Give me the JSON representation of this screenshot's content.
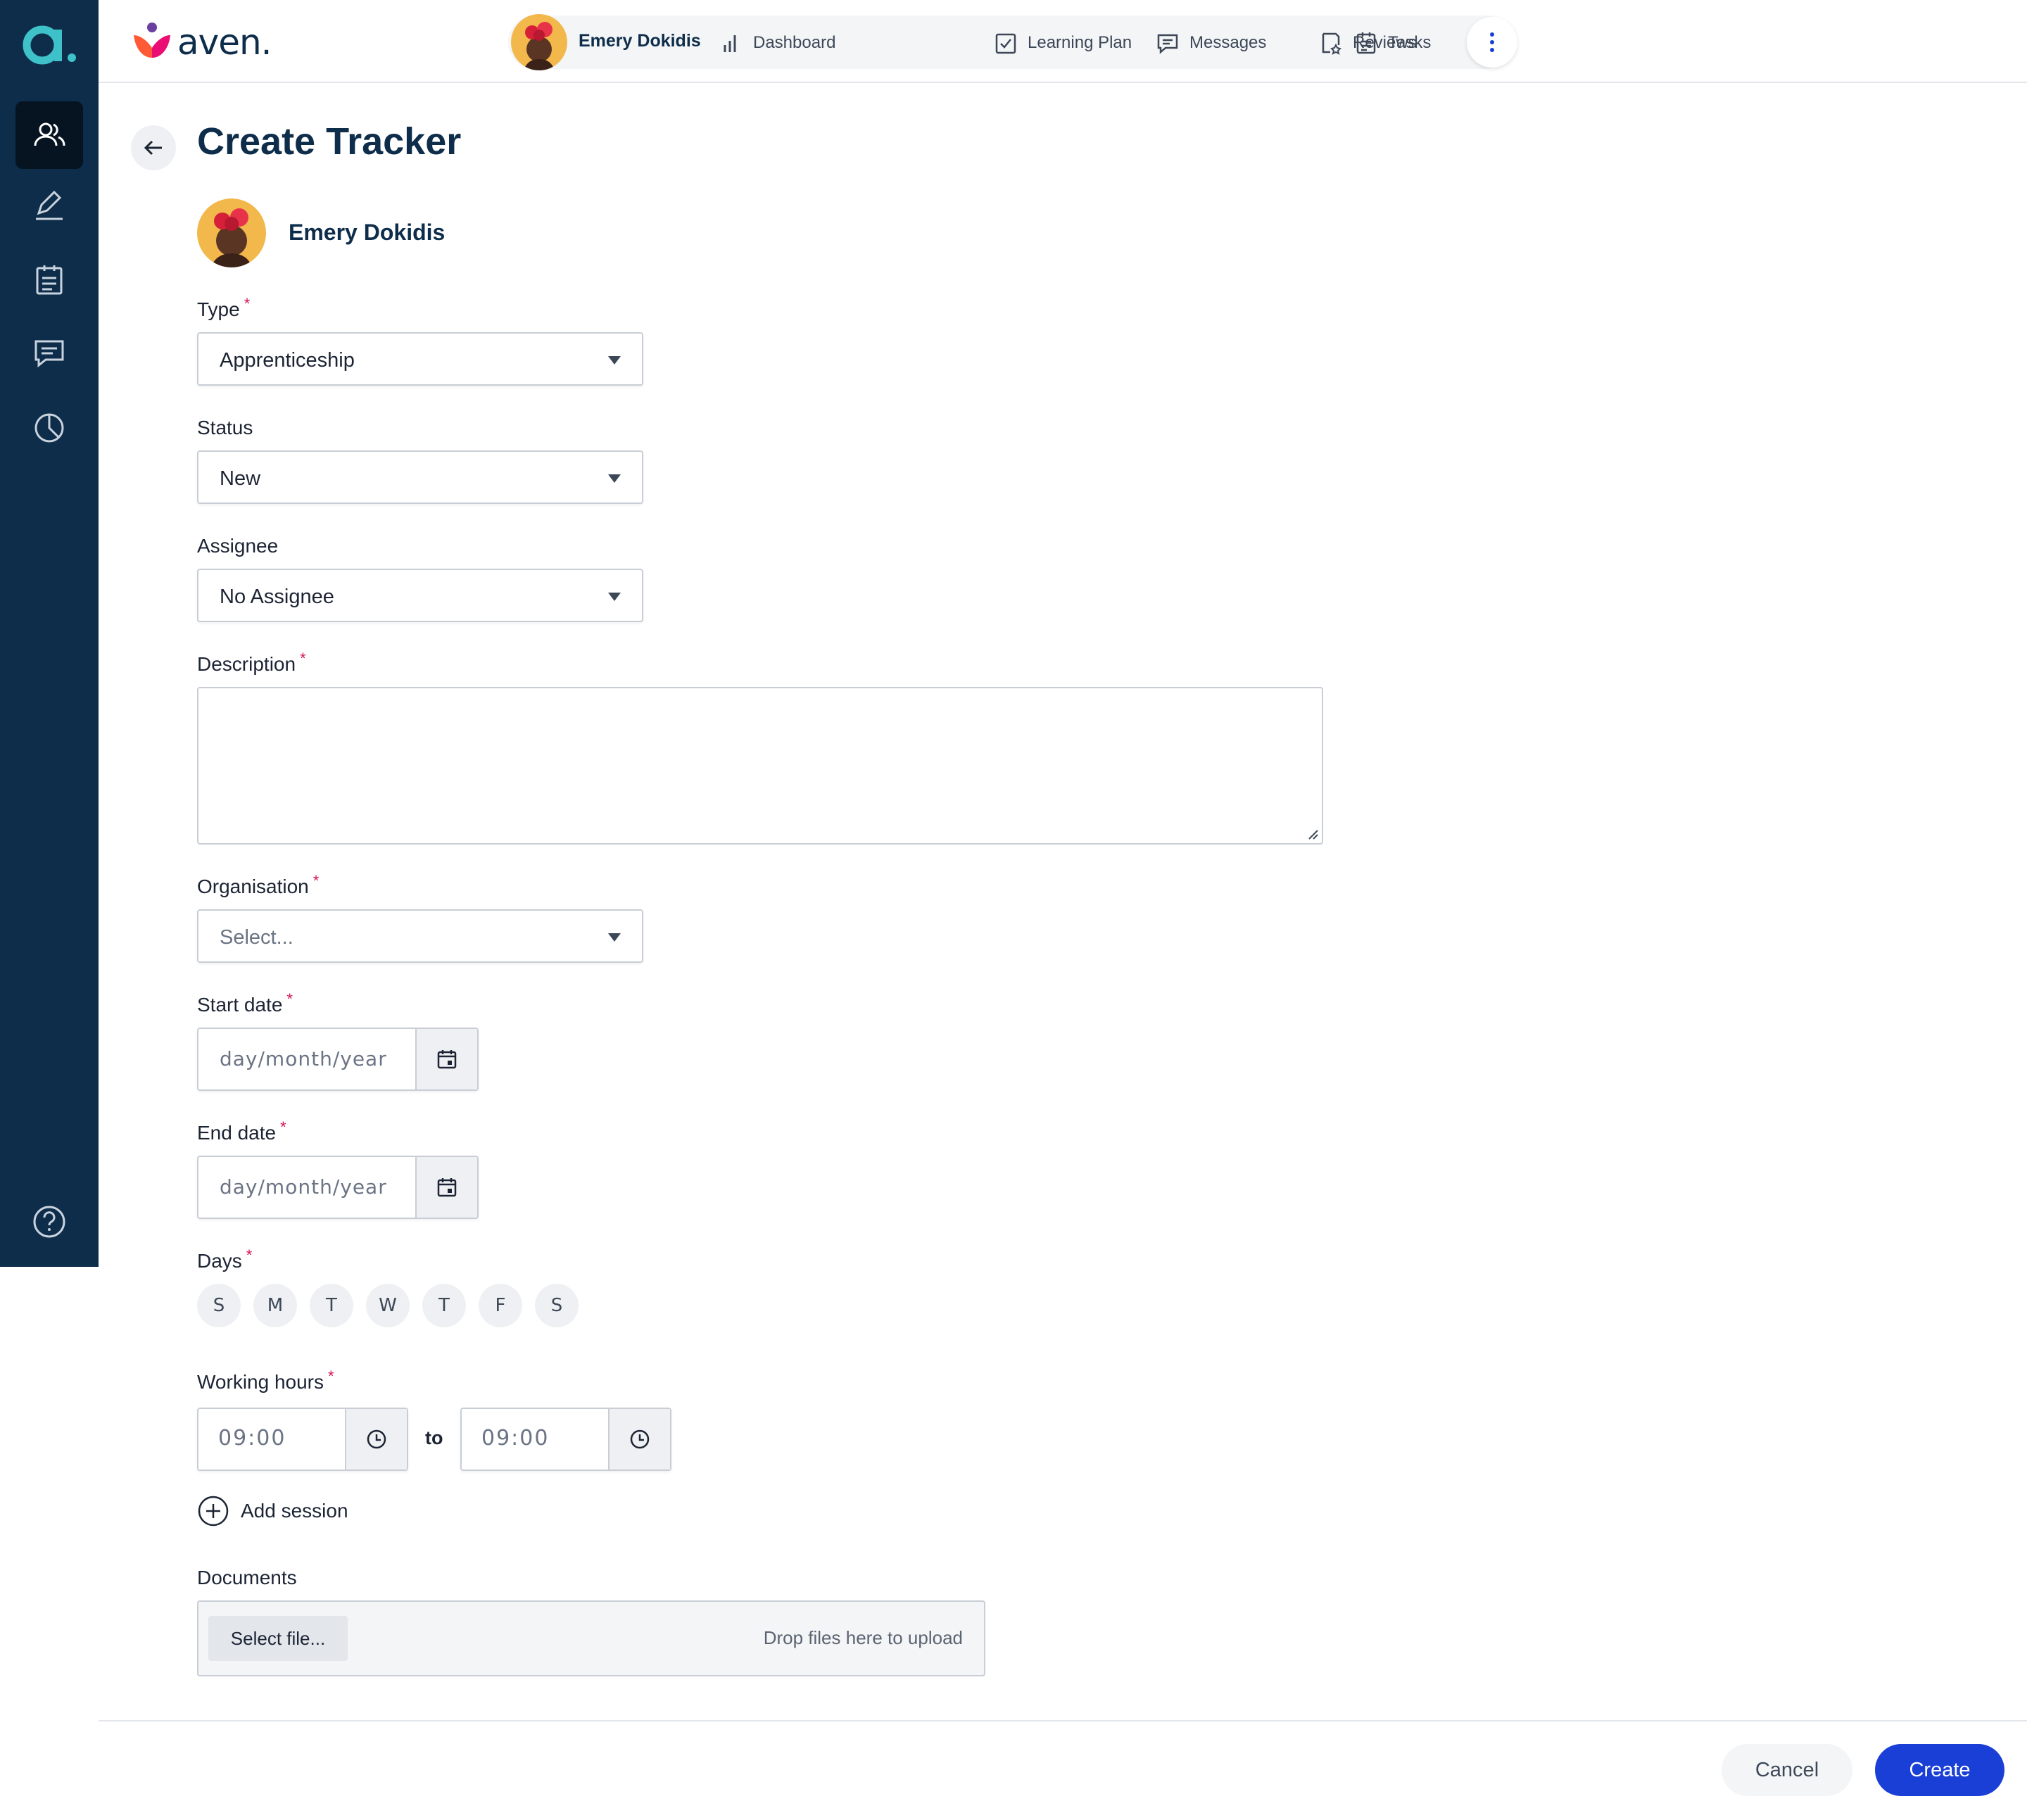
{
  "brand": {
    "name": "aven.",
    "rail_logo": "a."
  },
  "rail": {
    "items": [
      {
        "icon": "people-icon",
        "active": true
      },
      {
        "icon": "pen-signature-icon",
        "active": false
      },
      {
        "icon": "clipboard-icon",
        "active": false
      },
      {
        "icon": "chat-icon",
        "active": false
      },
      {
        "icon": "pie-chart-icon",
        "active": false
      }
    ],
    "help_icon": "help-icon"
  },
  "topnav": {
    "learner_name": "Emery Dokidis",
    "items": [
      {
        "label": "Dashboard",
        "icon": "bar-chart-icon"
      },
      {
        "label": "Learning Plan",
        "icon": "checkbox-icon"
      },
      {
        "label": "Messages",
        "icon": "message-icon"
      },
      {
        "label": "Reviews",
        "icon": "review-icon"
      },
      {
        "label": "Tasks",
        "icon": "clipboard-icon"
      }
    ],
    "more_icon": "more-vertical-icon"
  },
  "page": {
    "title": "Create Tracker",
    "learner_name": "Emery Dokidis"
  },
  "form": {
    "type": {
      "label": "Type",
      "value": "Apprenticeship",
      "required": "*"
    },
    "status": {
      "label": "Status",
      "value": "New"
    },
    "assignee": {
      "label": "Assignee",
      "value": "No Assignee"
    },
    "description": {
      "label": "Description",
      "required": "*",
      "value": ""
    },
    "organisation": {
      "label": "Organisation",
      "placeholder": "Select...",
      "required": "*"
    },
    "start_date": {
      "label": "Start date",
      "placeholder": "day/month/year",
      "required": "*"
    },
    "end_date": {
      "label": "End date",
      "placeholder": "day/month/year",
      "required": "*"
    },
    "days": {
      "label": "Days",
      "required": "*",
      "options": [
        "S",
        "M",
        "T",
        "W",
        "T",
        "F",
        "S"
      ]
    },
    "working_hours": {
      "label": "Working hours",
      "required": "*",
      "from": "09:00",
      "to_label": "to",
      "to": "09:00"
    },
    "add_session": "Add session",
    "documents": {
      "label": "Documents",
      "select_button": "Select file...",
      "drop_hint": "Drop files here to upload"
    }
  },
  "footer": {
    "cancel": "Cancel",
    "create": "Create"
  },
  "colors": {
    "rail_bg": "#0d2d4a",
    "primary": "#1a3fd6",
    "required": "#d4145a",
    "accent_teal": "#3ec1c9"
  }
}
